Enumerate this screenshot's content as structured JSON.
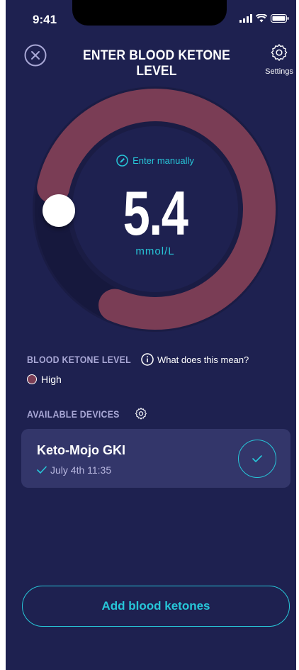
{
  "status_bar": {
    "time": "9:41"
  },
  "header": {
    "title": "ENTER BLOOD KETONE LEVEL",
    "settings_label": "Settings"
  },
  "gauge": {
    "enter_manually": "Enter manually",
    "value": "5.4",
    "unit": "mmol/L",
    "level_fraction": 0.78
  },
  "ketone": {
    "section_label": "BLOOD KETONE LEVEL",
    "info_link": "What does this mean?",
    "level": "High"
  },
  "devices": {
    "section_label": "AVAILABLE DEVICES",
    "items": [
      {
        "name": "Keto-Mojo GKI",
        "timestamp": "July 4th 11:35"
      }
    ]
  },
  "actions": {
    "add_label": "Add blood ketones"
  },
  "colors": {
    "background": "#1e2150",
    "accent": "#27c6d8",
    "high": "#7a3d55",
    "card": "#33366a"
  }
}
